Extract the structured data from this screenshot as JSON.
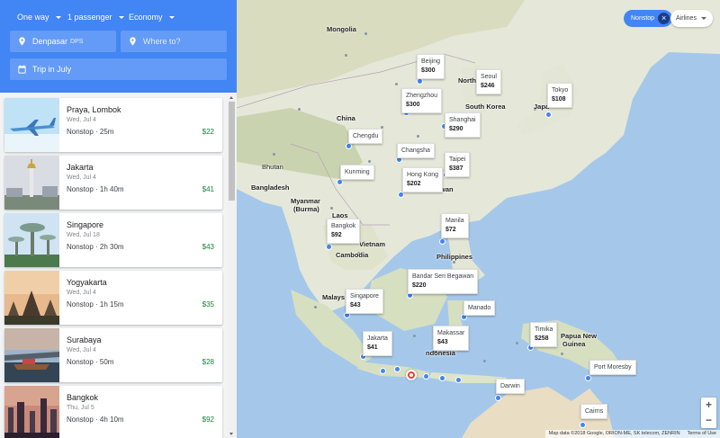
{
  "search": {
    "trip_type": "One way",
    "passengers": "1 passenger",
    "cabin": "Economy",
    "origin_city": "Denpasar",
    "origin_code": "DPS",
    "destination_placeholder": "Where to?",
    "dates": "Trip in July"
  },
  "results": [
    {
      "city": "Praya, Lombok",
      "date": "Wed, Jul 4",
      "duration": "Nonstop · 25m",
      "price": "$22"
    },
    {
      "city": "Jakarta",
      "date": "Wed, Jul 4",
      "duration": "Nonstop · 1h 40m",
      "price": "$41"
    },
    {
      "city": "Singapore",
      "date": "Wed, Jul 18",
      "duration": "Nonstop · 2h 30m",
      "price": "$43"
    },
    {
      "city": "Yogyakarta",
      "date": "Wed, Jul 4",
      "duration": "Nonstop · 1h 15m",
      "price": "$35"
    },
    {
      "city": "Surabaya",
      "date": "Wed, Jul 4",
      "duration": "Nonstop · 50m",
      "price": "$28"
    },
    {
      "city": "Bangkok",
      "date": "Thu, Jul 5",
      "duration": "Nonstop · 4h 10m",
      "price": "$92"
    }
  ],
  "filters": {
    "nonstop": "Nonstop",
    "airlines": "Airlines"
  },
  "map_destinations": [
    {
      "city": "Beijing",
      "price": "$300"
    },
    {
      "city": "Seoul",
      "price": "$246"
    },
    {
      "city": "Tokyo",
      "price": "$108"
    },
    {
      "city": "Zhengzhou",
      "price": "$300"
    },
    {
      "city": "Shanghai",
      "price": "$290"
    },
    {
      "city": "Chengdu",
      "price": ""
    },
    {
      "city": "Changsha",
      "price": ""
    },
    {
      "city": "Taipei",
      "price": "$387"
    },
    {
      "city": "Kunming",
      "price": ""
    },
    {
      "city": "Hong Kong",
      "price": "$202"
    },
    {
      "city": "Manila",
      "price": "$72"
    },
    {
      "city": "Bangkok",
      "price": "$92"
    },
    {
      "city": "Bandar Seri Begawan",
      "price": "$220"
    },
    {
      "city": "Singapore",
      "price": "$43"
    },
    {
      "city": "Manado",
      "price": ""
    },
    {
      "city": "Jakarta",
      "price": "$41"
    },
    {
      "city": "Makassar",
      "price": "$43"
    },
    {
      "city": "Timika",
      "price": "$258"
    },
    {
      "city": "Port Moresby",
      "price": ""
    },
    {
      "city": "Darwin",
      "price": ""
    },
    {
      "city": "Cairns",
      "price": ""
    }
  ],
  "map_labels": {
    "mongolia": "Mongolia",
    "china": "China",
    "north_korea": "North",
    "south_korea": "South Korea",
    "japan": "Japa",
    "bhutan": "Bhutan",
    "bangladesh": "Bangladesh",
    "myanmar": "Myanmar",
    "burma": "(Burma)",
    "laos": "Laos",
    "vietnam": "Vietnam",
    "cambodia": "Cambodia",
    "philippines": "Philippines",
    "malaysia": "Malays",
    "indonesia": "ndonesia",
    "png_1": "Papua New",
    "png_2": "Guinea",
    "taiwan": "wan"
  },
  "zoom": {
    "in": "+",
    "out": "−"
  },
  "attribution": {
    "data": "Map data ©2018 Google, ORION-ME, SK telecom, ZENRIN",
    "terms": "Terms of Use"
  },
  "colors": {
    "accent": "#4285f4",
    "price_green": "#188038",
    "origin_pin": "#ea4335",
    "water": "#a5c8ea",
    "land": "#e8eadf"
  }
}
